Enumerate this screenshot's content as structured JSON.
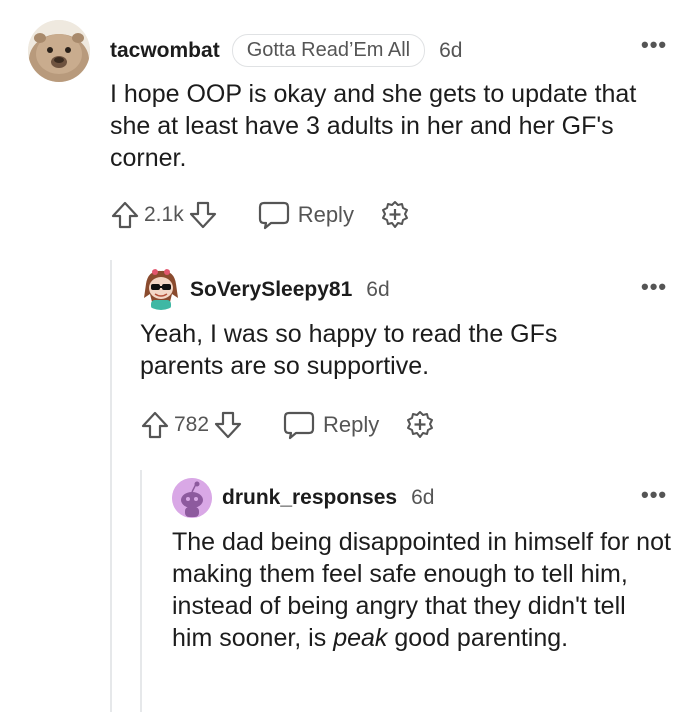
{
  "comments": [
    {
      "username": "tacwombat",
      "flair": "Gotta Read’Em All",
      "time": "6d",
      "body": "I hope OOP is okay and she gets to update that she at least have 3 adults in her and her GF's corner.",
      "votes": "2.1k",
      "reply_label": "Reply",
      "avatar_icon": "wombat-avatar-icon"
    },
    {
      "username": "SoVerySleepy81",
      "time": "6d",
      "body": "Yeah, I was so happy to read the GFs parents are so supportive.",
      "votes": "782",
      "reply_label": "Reply",
      "avatar_icon": "snoo-sunglasses-avatar-icon"
    },
    {
      "username": "drunk_responses",
      "time": "6d",
      "body_parts": [
        "The dad being disappointed in himself for not making them feel safe enough to tell him, instead of being angry that they didn't tell him sooner, is ",
        "peak",
        " good parenting."
      ],
      "avatar_icon": "snoo-purple-avatar-icon"
    }
  ],
  "colors": {
    "text": "#1c1c1c",
    "meta": "#555555",
    "thread_line": "#e6e8ea",
    "avatar_purple": "#d9a8e6"
  }
}
